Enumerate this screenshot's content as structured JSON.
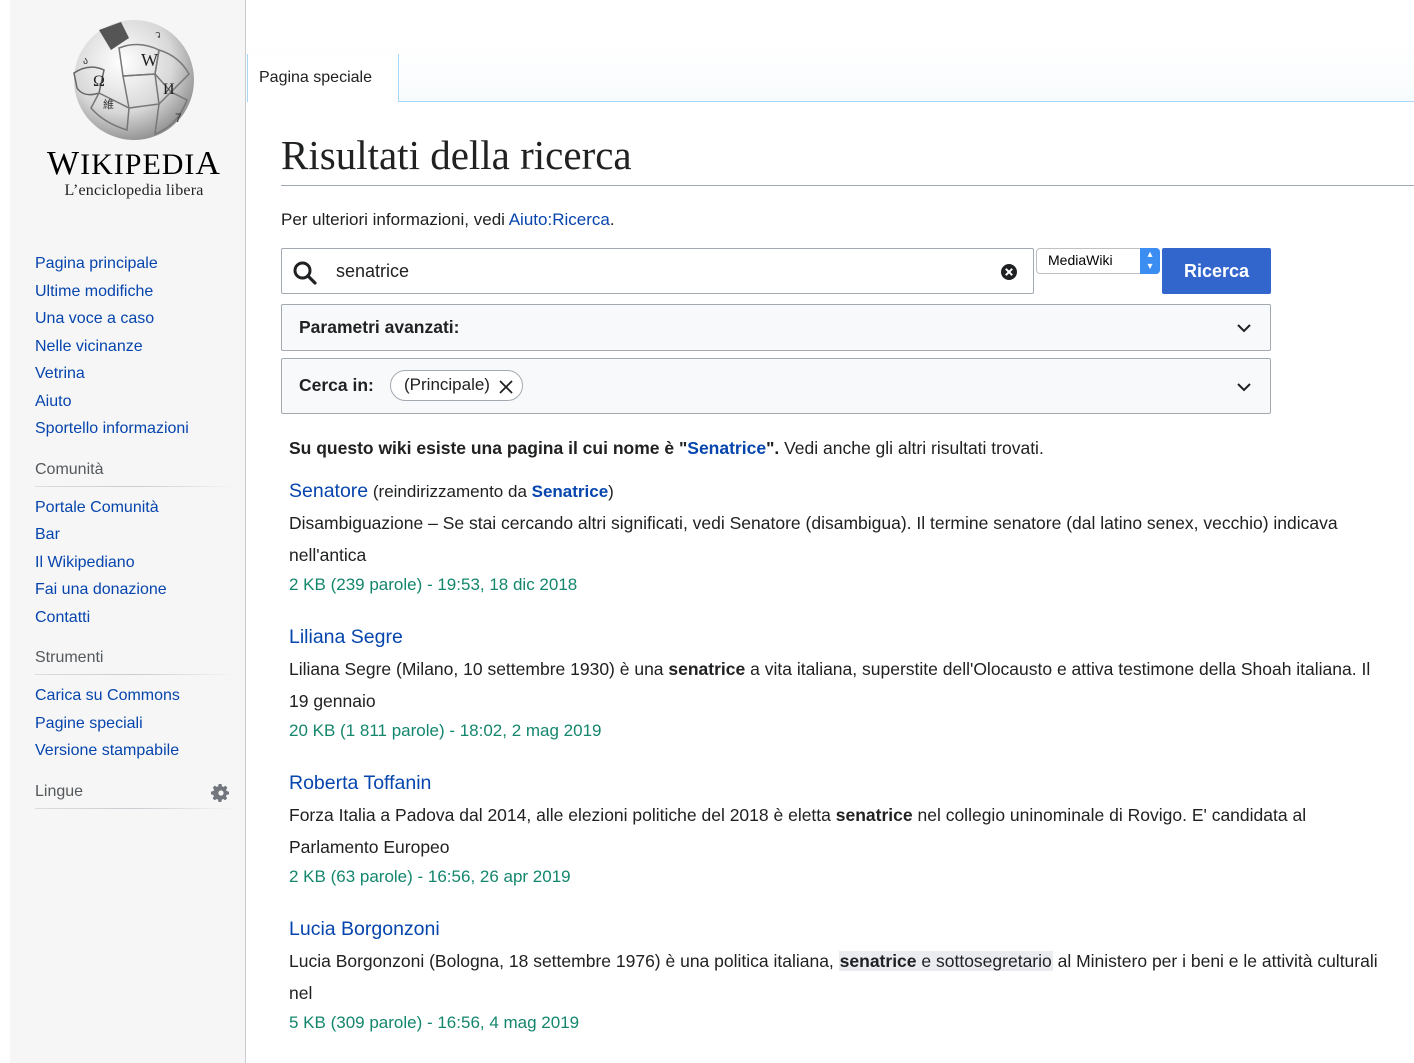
{
  "logo": {
    "wordmark": "Wikipedia",
    "tagline": "L’enciclopedia libera"
  },
  "sidebar": {
    "main_links": [
      "Pagina principale",
      "Ultime modifiche",
      "Una voce a caso",
      "Nelle vicinanze",
      "Vetrina",
      "Aiuto",
      "Sportello informazioni"
    ],
    "community_heading": "Comunità",
    "community_links": [
      "Portale Comunità",
      "Bar",
      "Il Wikipediano",
      "Fai una donazione",
      "Contatti"
    ],
    "tools_heading": "Strumenti",
    "tools_links": [
      "Carica su Commons",
      "Pagine speciali",
      "Versione stampabile"
    ],
    "languages_heading": "Lingue"
  },
  "tabs": {
    "special_page": "Pagina speciale"
  },
  "page": {
    "title": "Risultati della ricerca",
    "info_prefix": "Per ulteriori informazioni, vedi ",
    "info_link": "Aiuto:Ricerca",
    "info_suffix": "."
  },
  "search": {
    "value": "senatrice",
    "engine_select": "MediaWiki",
    "button_label": "Ricerca"
  },
  "advanced": {
    "label": "Parametri avanzati:"
  },
  "namespace": {
    "label": "Cerca in:",
    "chip": "(Principale)"
  },
  "exact_match": {
    "prefix": "Su questo wiki esiste una pagina il cui nome è \"",
    "link": "Senatrice",
    "suffix": "\".",
    "see_also": " Vedi anche gli altri risultati trovati."
  },
  "results": [
    {
      "title": "Senatore",
      "redirect_prefix": " (reindirizzamento da ",
      "redirect_link": "Senatrice",
      "redirect_suffix": ")",
      "snippet_a": "Disambiguazione – Se stai cercando altri significati, vedi Senatore (disambigua). Il termine senatore (dal latino senex, vecchio) indicava nell'antica",
      "meta": "2 KB (239 parole) - 19:53, 18 dic 2018"
    },
    {
      "title": "Liliana Segre",
      "snippet_a": "Liliana Segre (Milano, 10 settembre 1930) è una ",
      "snippet_bold": "senatrice",
      "snippet_b": " a vita italiana, superstite dell'Olocausto e attiva testimone della Shoah italiana. Il 19 gennaio",
      "meta": "20 KB (1 811 parole) - 18:02, 2 mag 2019"
    },
    {
      "title": "Roberta Toffanin",
      "snippet_a": "Forza Italia a Padova dal 2014, alle elezioni politiche del 2018 è eletta ",
      "snippet_bold": "senatrice",
      "snippet_b": " nel collegio uninominale di Rovigo. E' candidata al Parlamento Europeo",
      "meta": "2 KB (63 parole) - 16:56, 26 apr 2019"
    },
    {
      "title": "Lucia Borgonzoni",
      "snippet_a": "Lucia Borgonzoni (Bologna, 18 settembre 1976) è una politica italiana, ",
      "snippet_bold": "senatrice",
      "snippet_hl": " e sottosegretario",
      "snippet_b": " al Ministero per i beni e le attività culturali nel",
      "meta": "5 KB (309 parole) - 16:56, 4 mag 2019"
    }
  ]
}
